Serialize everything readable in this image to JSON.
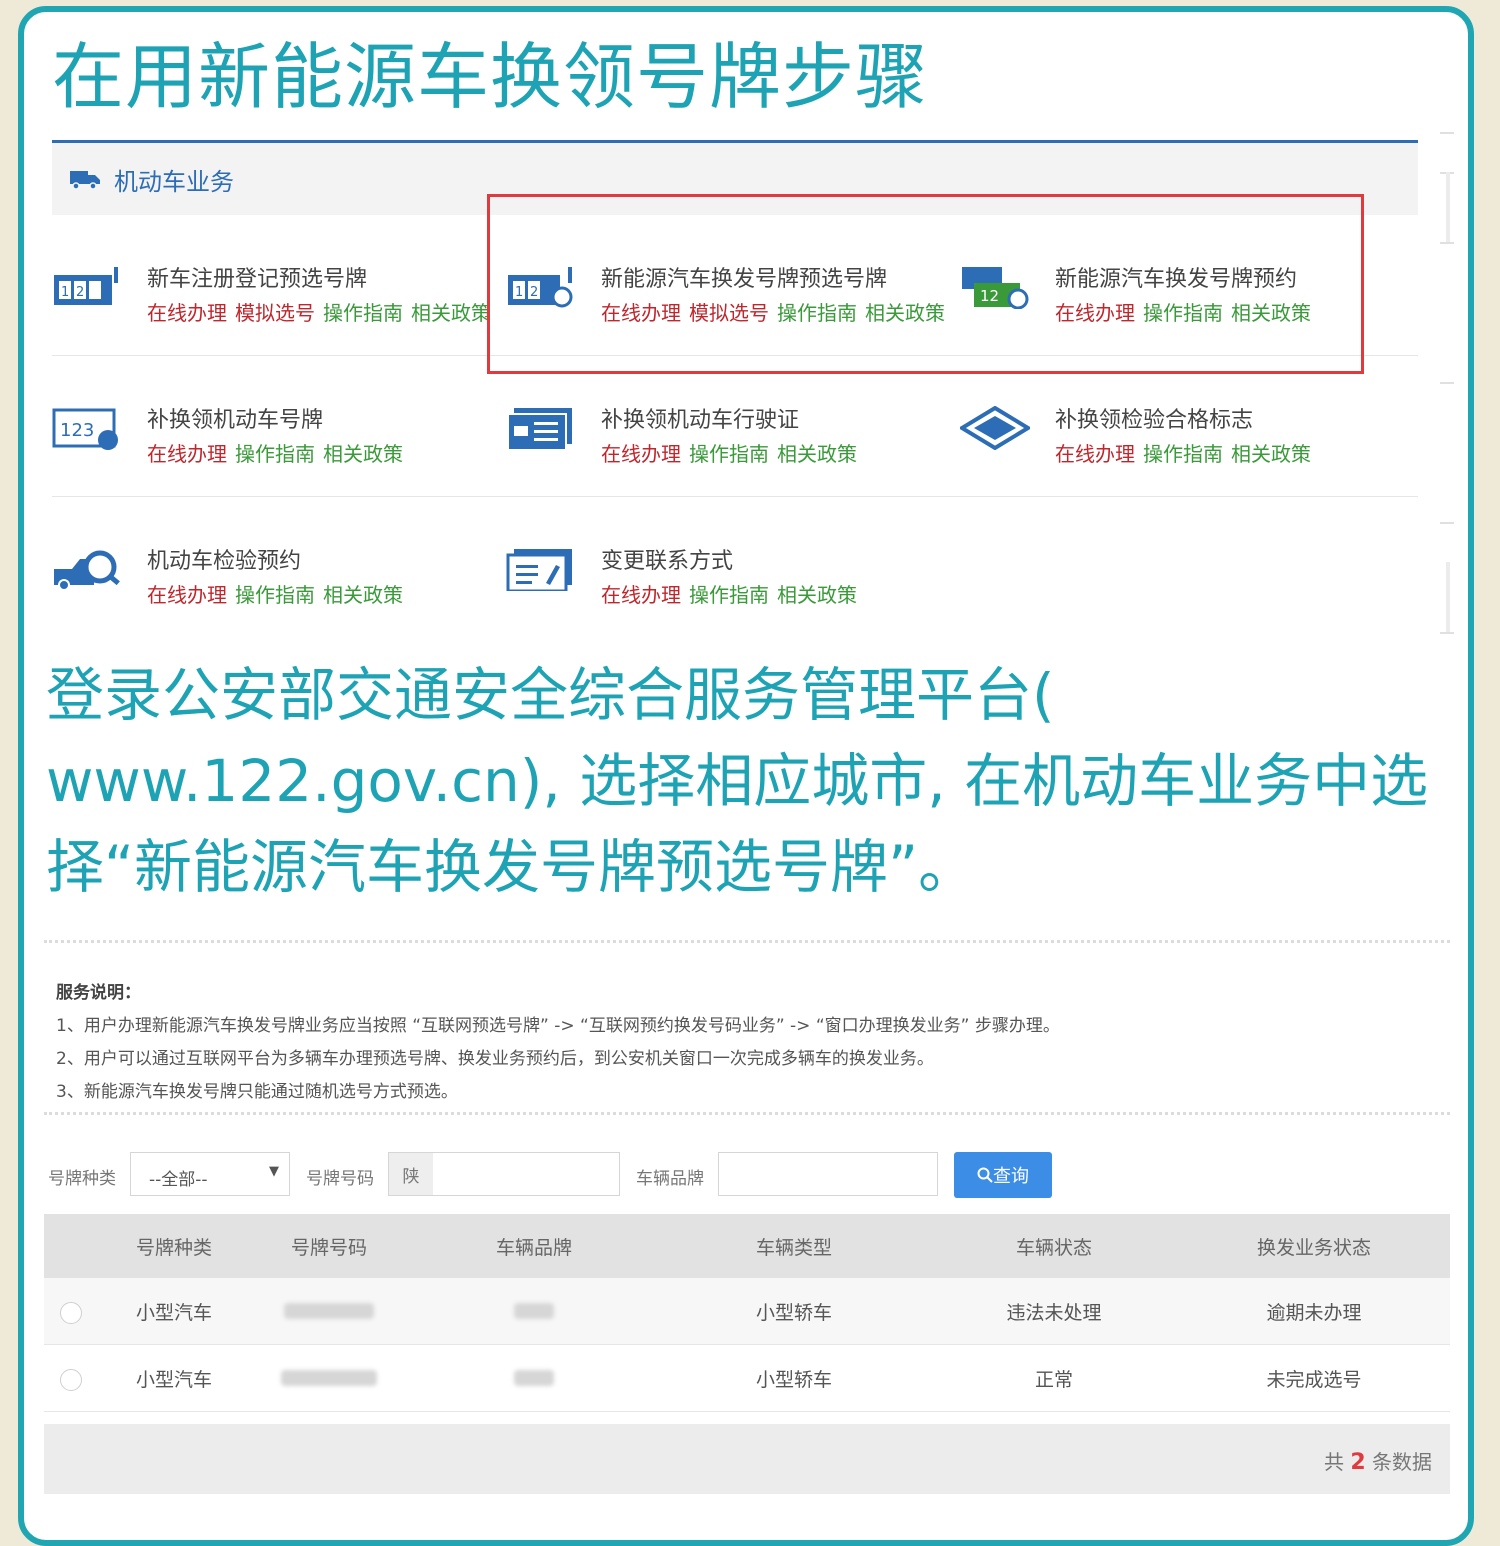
{
  "title": "在用新能源车换领号牌步骤",
  "portal": {
    "section": "机动车业务",
    "services": [
      {
        "name": "新车注册登记预选号牌",
        "links": [
          {
            "t": "在线办理",
            "c": "red"
          },
          {
            "t": "模拟选号",
            "c": "red"
          },
          {
            "t": "操作指南",
            "c": "green"
          },
          {
            "t": "相关政策",
            "c": "green"
          }
        ],
        "icon": "plate-select-icon"
      },
      {
        "name": "新能源汽车换发号牌预选号牌",
        "links": [
          {
            "t": "在线办理",
            "c": "red"
          },
          {
            "t": "模拟选号",
            "c": "red"
          },
          {
            "t": "操作指南",
            "c": "green"
          },
          {
            "t": "相关政策",
            "c": "green"
          }
        ],
        "icon": "ev-plate-select-icon"
      },
      {
        "name": "新能源汽车换发号牌预约",
        "links": [
          {
            "t": "在线办理",
            "c": "red"
          },
          {
            "t": "操作指南",
            "c": "green"
          },
          {
            "t": "相关政策",
            "c": "green"
          }
        ],
        "icon": "ev-plate-appointment-icon"
      },
      {
        "name": "补换领机动车号牌",
        "links": [
          {
            "t": "在线办理",
            "c": "red"
          },
          {
            "t": "操作指南",
            "c": "green"
          },
          {
            "t": "相关政策",
            "c": "green"
          }
        ],
        "icon": "plate-replace-icon"
      },
      {
        "name": "补换领机动车行驶证",
        "links": [
          {
            "t": "在线办理",
            "c": "red"
          },
          {
            "t": "操作指南",
            "c": "green"
          },
          {
            "t": "相关政策",
            "c": "green"
          }
        ],
        "icon": "license-card-icon"
      },
      {
        "name": "补换领检验合格标志",
        "links": [
          {
            "t": "在线办理",
            "c": "red"
          },
          {
            "t": "操作指南",
            "c": "green"
          },
          {
            "t": "相关政策",
            "c": "green"
          }
        ],
        "icon": "inspection-badge-icon"
      },
      {
        "name": "机动车检验预约",
        "links": [
          {
            "t": "在线办理",
            "c": "red"
          },
          {
            "t": "操作指南",
            "c": "green"
          },
          {
            "t": "相关政策",
            "c": "green"
          }
        ],
        "icon": "vehicle-inspection-icon"
      },
      {
        "name": "变更联系方式",
        "links": [
          {
            "t": "在线办理",
            "c": "red"
          },
          {
            "t": "操作指南",
            "c": "green"
          },
          {
            "t": "相关政策",
            "c": "green"
          }
        ],
        "icon": "contact-edit-icon"
      }
    ]
  },
  "caption": "登录公安部交通安全综合服务管理平台( www.122.gov.cn), 选择相应城市, 在机动车业务中选择“新能源汽车换发号牌预选号牌”。",
  "notes": {
    "heading": "服务说明：",
    "items": [
      "1、用户办理新能源汽车换发号牌业务应当按照 “互联网预选号牌” -> “互联网预约换发号码业务” -> “窗口办理换发业务” 步骤办理。",
      "2、用户可以通过互联网平台为多辆车办理预选号牌、换发业务预约后，到公安机关窗口一次完成多辆车的换发业务。",
      "3、新能源汽车换发号牌只能通过随机选号方式预选。"
    ]
  },
  "search": {
    "plate_type_label": "号牌种类",
    "plate_type_value": "--全部--",
    "plate_no_label": "号牌号码",
    "plate_prefix": "陕",
    "brand_label": "车辆品牌",
    "button": "查询"
  },
  "table": {
    "headers": [
      "号牌种类",
      "号牌号码",
      "车辆品牌",
      "车辆类型",
      "车辆状态",
      "换发业务状态"
    ],
    "rows": [
      {
        "plate_type": "小型汽车",
        "vehicle_type": "小型轿车",
        "vehicle_status": "违法未处理",
        "business_status": "逾期未办理"
      },
      {
        "plate_type": "小型汽车",
        "vehicle_type": "小型轿车",
        "vehicle_status": "正常",
        "business_status": "未完成选号"
      }
    ],
    "footer_prefix": "共",
    "footer_count": "2",
    "footer_suffix": "条数据"
  }
}
